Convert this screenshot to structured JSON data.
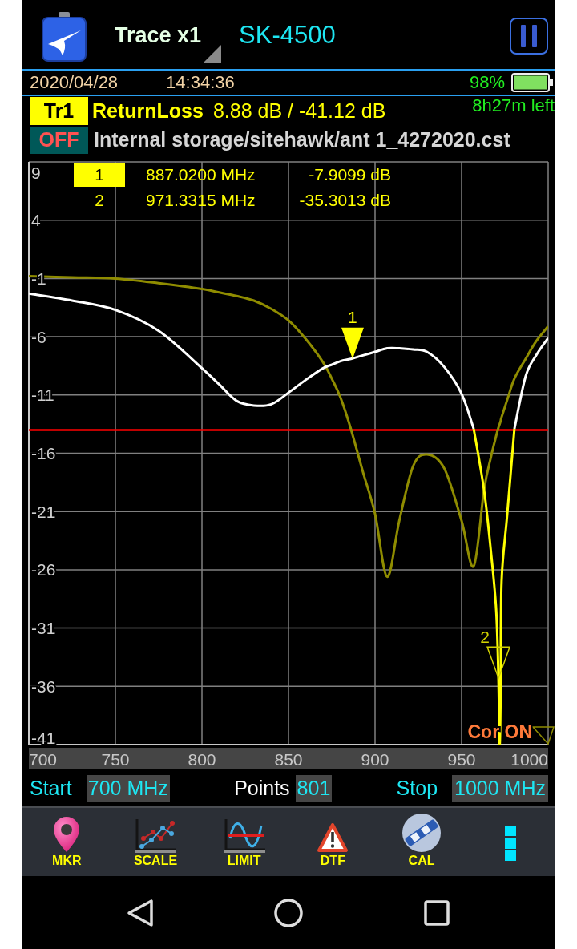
{
  "header": {
    "title": "Trace x1",
    "model": "SK-4500"
  },
  "status_bar": {
    "date": "2020/04/28",
    "time": "14:34:36",
    "battery": "98%",
    "remaining": "8h27m left"
  },
  "trace": {
    "label": "Tr1",
    "measurement": "ReturnLoss",
    "reading": "8.88 dB / -41.12 dB"
  },
  "file": {
    "toggle": "OFF",
    "path": "Internal storage/sitehawk/ant 1_4272020.cst"
  },
  "chart": {
    "marker_table": [
      {
        "number": "1",
        "frequency": "887.0200 MHz",
        "value": "-7.9099 dB",
        "selected": true
      },
      {
        "number": "2",
        "frequency": "971.3315 MHz",
        "value": "-35.3013 dB",
        "selected": false
      }
    ],
    "status_text": "Cor ON",
    "chart_data": {
      "type": "line",
      "x": [
        700,
        725,
        750,
        775,
        800,
        810,
        820,
        830,
        840,
        850,
        860,
        870,
        875,
        880,
        886,
        893,
        900,
        907,
        914,
        922,
        930,
        940,
        950,
        957,
        963,
        967,
        970,
        971.3,
        972,
        972.6,
        973.1,
        976.4,
        980.5,
        987,
        993,
        1000
      ],
      "series": [
        {
          "color": "#8f8c00",
          "values": [
            -0.8,
            -0.9,
            -1.0,
            -1.4,
            -1.9,
            -2.2,
            -2.5,
            -2.9,
            -3.6,
            -4.6,
            -6.2,
            -8.2,
            -9.6,
            -11.2,
            -13.9,
            -17.6,
            -21.2,
            -26.6,
            -21.8,
            -17.1,
            -16.1,
            -17.3,
            -21.8,
            -25.7,
            -19.1,
            -16.3,
            -14.5,
            -13.8,
            -13.5,
            -13.2,
            -12.9,
            -11.4,
            -9.6,
            -7.9,
            -6.4,
            -5.1
          ]
        },
        {
          "color": "#ffffff",
          "values": [
            -2.3,
            -2.9,
            -3.7,
            -5.5,
            -8.7,
            -10.1,
            -11.5,
            -11.9,
            -11.8,
            -10.8,
            -9.7,
            -8.7,
            -8.4,
            -8.1,
            -7.9,
            -7.6,
            -7.3,
            -7.0,
            -7.0,
            -7.1,
            -7.3,
            -8.6,
            -10.9,
            -13.9,
            null,
            null,
            null,
            null,
            null,
            null,
            null,
            null,
            -13.9,
            -9.4,
            -7.6,
            -6.1
          ]
        },
        {
          "color": "#ffff00",
          "values": [
            null,
            null,
            null,
            null,
            null,
            null,
            null,
            null,
            null,
            null,
            null,
            null,
            null,
            null,
            null,
            null,
            null,
            null,
            null,
            null,
            null,
            null,
            null,
            -13.9,
            -19.2,
            -24.5,
            -29.5,
            -35.3,
            -41,
            -36,
            -27,
            -21.2,
            -13.9,
            null,
            null,
            null
          ]
        }
      ],
      "xlim": [
        700,
        1000
      ],
      "ylim": [
        -41,
        9
      ],
      "xticks": [
        700,
        750,
        800,
        850,
        900,
        950,
        1000
      ],
      "yticks": [
        9,
        4,
        -1,
        -6,
        -11,
        -16,
        -21,
        -26,
        -31,
        -36,
        -41
      ],
      "grid": true,
      "ref_lines": [
        {
          "axis": "y",
          "value": -14,
          "color": "#ff0000"
        }
      ],
      "annotations": [
        {
          "text": "1",
          "x": 887.02,
          "y": -7.9099
        },
        {
          "text": "2",
          "x": 971.3315,
          "y": -35.3013
        }
      ]
    }
  },
  "sweep": {
    "start_label": "Start",
    "start_value": "700 MHz",
    "points_label": "Points",
    "points_value": "801",
    "stop_label": "Stop",
    "stop_value": "1000 MHz"
  },
  "toolbar": [
    {
      "kind": "pin",
      "label": "MKR"
    },
    {
      "kind": "scale",
      "label": "SCALE"
    },
    {
      "kind": "limit",
      "label": "LIMIT"
    },
    {
      "kind": "warning",
      "label": "DTF"
    },
    {
      "kind": "cal",
      "label": "CAL"
    },
    {
      "kind": "more"
    }
  ]
}
